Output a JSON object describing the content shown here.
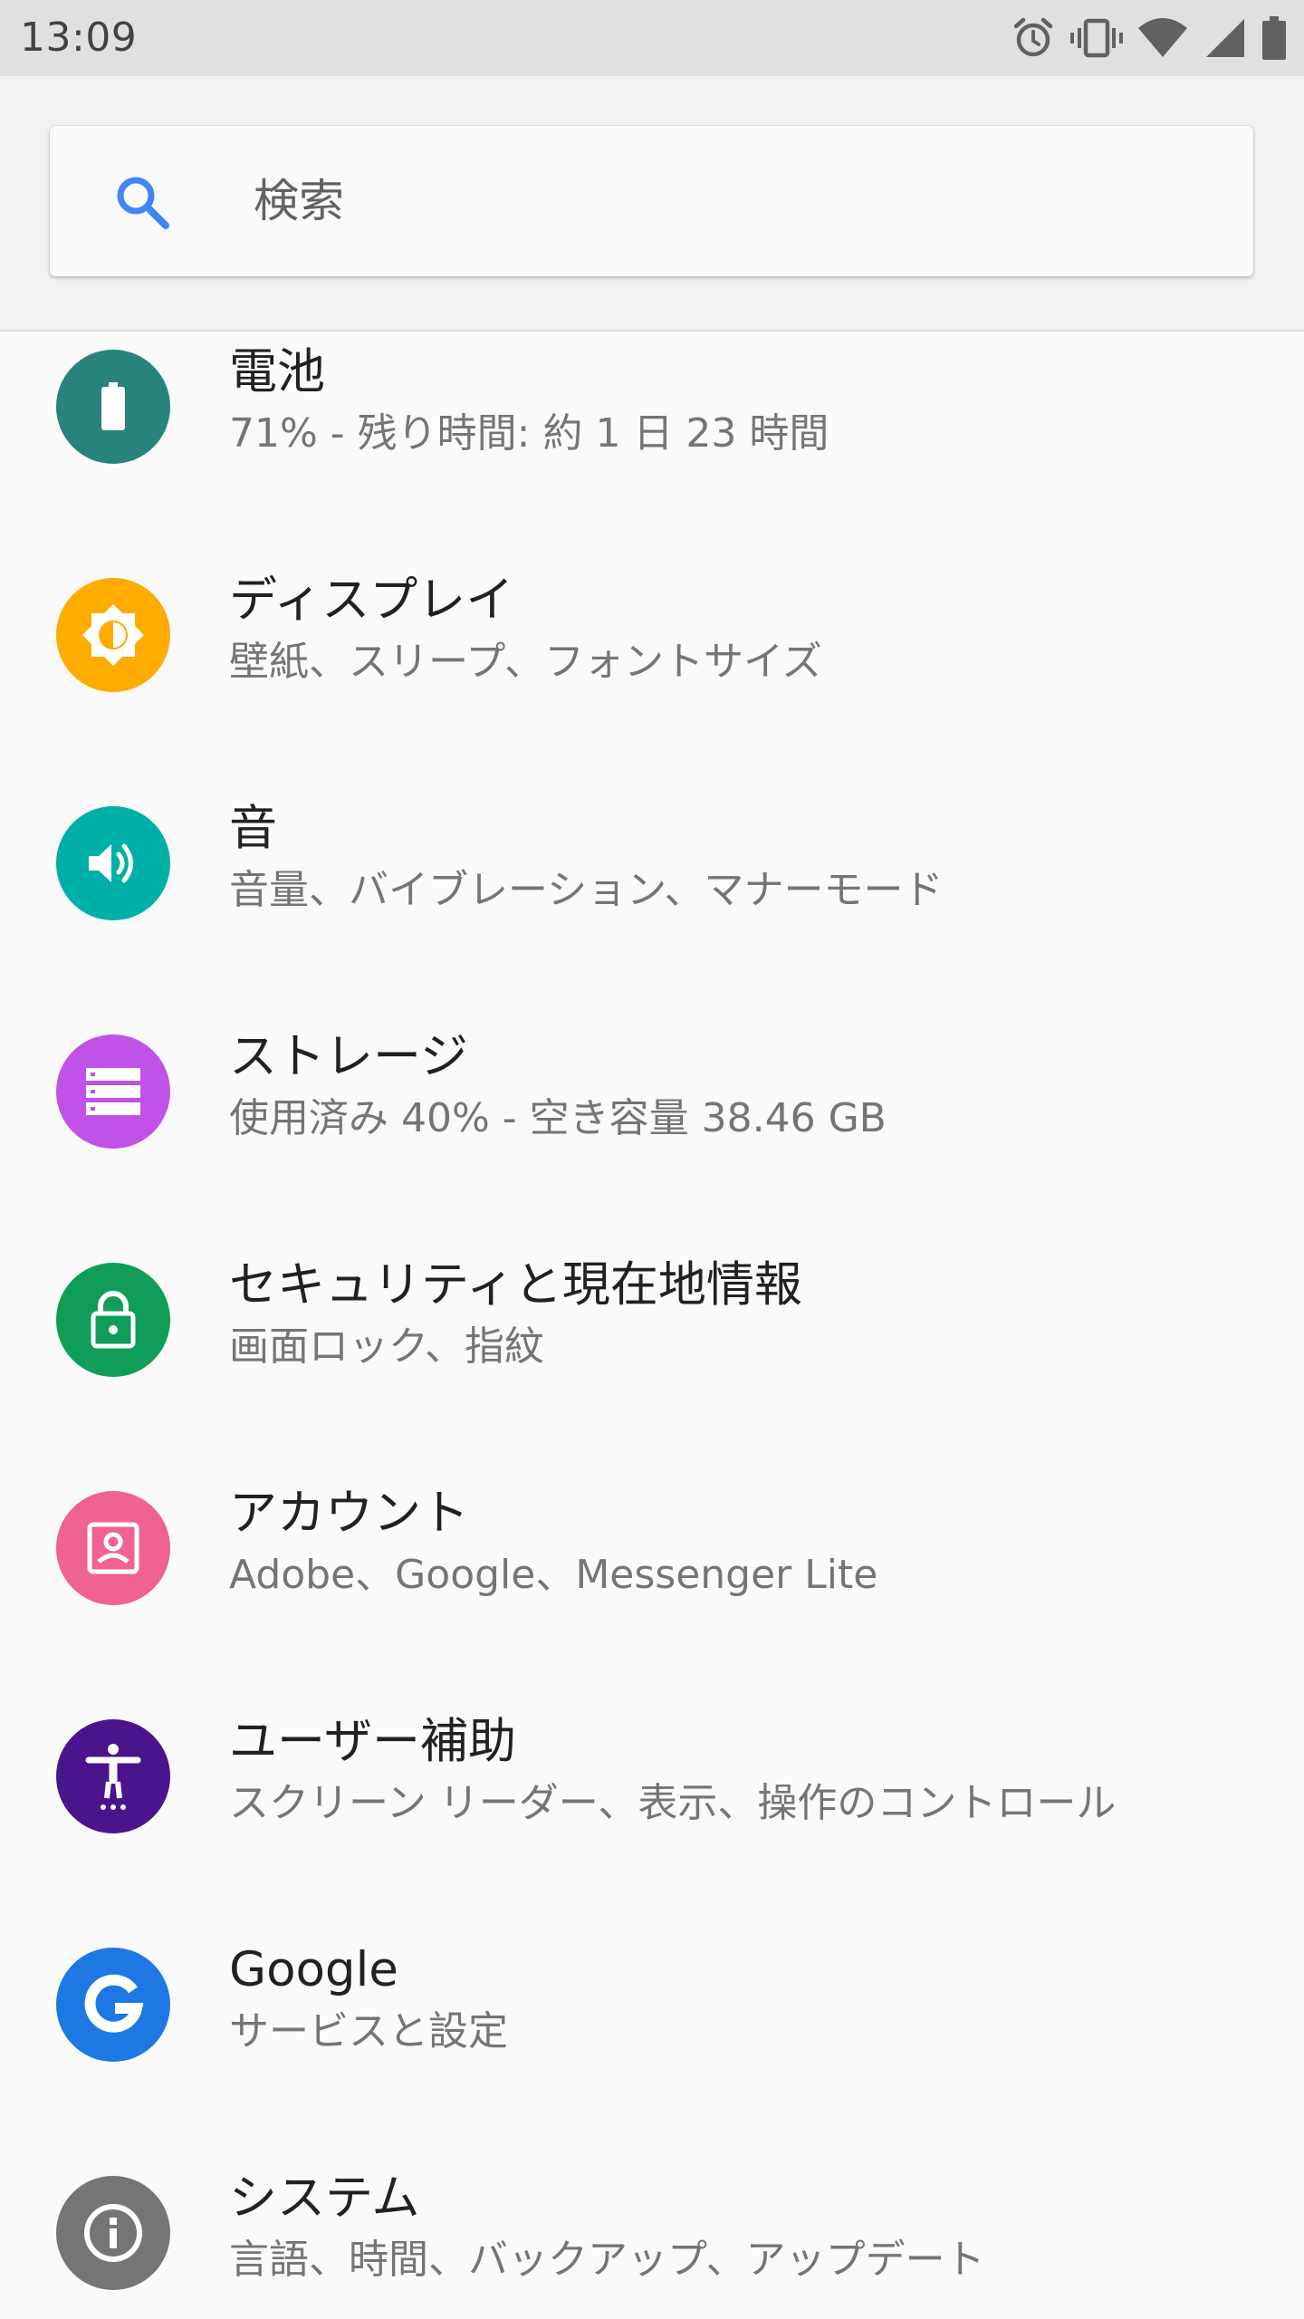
{
  "status_bar": {
    "time": "13:09",
    "icons": [
      "alarm-icon",
      "vibrate-icon",
      "wifi-icon",
      "cell-signal-icon",
      "battery-icon"
    ]
  },
  "search": {
    "placeholder": "検索",
    "value": ""
  },
  "settings": [
    {
      "title": "電池",
      "subtitle": "71% - 残り時間: 約 1 日 23 時間",
      "icon": "battery-icon",
      "color": "#28837a"
    },
    {
      "title": "ディスプレイ",
      "subtitle": "壁紙、スリープ、フォントサイズ",
      "icon": "brightness-icon",
      "color": "#ffab00"
    },
    {
      "title": "音",
      "subtitle": "音量、バイブレーション、マナーモード",
      "icon": "volume-icon",
      "color": "#00b0a8"
    },
    {
      "title": "ストレージ",
      "subtitle": "使用済み 40% - 空き容量 38.46 GB",
      "icon": "storage-icon",
      "color": "#c152e7"
    },
    {
      "title": "セキュリティと現在地情報",
      "subtitle": "画面ロック、指紋",
      "icon": "lock-icon",
      "color": "#109d58"
    },
    {
      "title": "アカウント",
      "subtitle": "Adobe、Google、Messenger Lite",
      "icon": "account-icon",
      "color": "#f06292"
    },
    {
      "title": "ユーザー補助",
      "subtitle": "スクリーン リーダー、表示、操作のコントロール",
      "icon": "accessibility-icon",
      "color": "#4a148c"
    },
    {
      "title": "Google",
      "subtitle": "サービスと設定",
      "icon": "google-icon",
      "color": "#1e78e4"
    },
    {
      "title": "システム",
      "subtitle": "言語、時間、バックアップ、アップデート",
      "icon": "info-icon",
      "color": "#757575"
    }
  ]
}
